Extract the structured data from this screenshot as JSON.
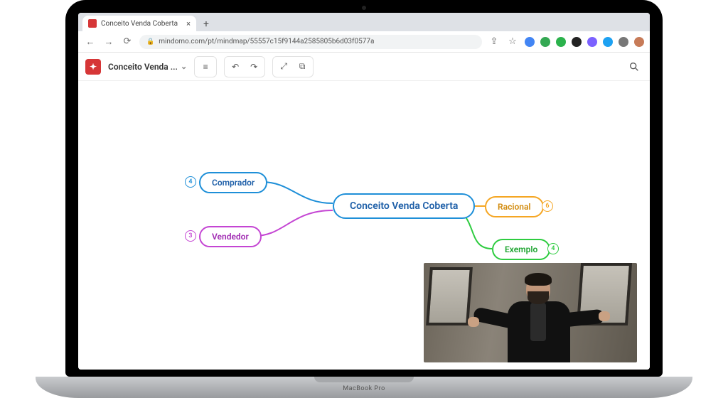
{
  "laptop_label": "MacBook Pro",
  "browser": {
    "tab_title": "Conceito Venda Coberta",
    "url": "mindomo.com/pt/mindmap/55557c15f9144a2585805b6d03f0577a"
  },
  "toolbar": {
    "doc_title": "Conceito Venda ..."
  },
  "mindmap": {
    "center": "Conceito Venda Coberta",
    "nodes": {
      "comprador": {
        "label": "Comprador",
        "count": "4"
      },
      "vendedor": {
        "label": "Vendedor",
        "count": "3"
      },
      "racional": {
        "label": "Racional",
        "count": "6"
      },
      "exemplo": {
        "label": "Exemplo",
        "count": "4"
      }
    }
  }
}
